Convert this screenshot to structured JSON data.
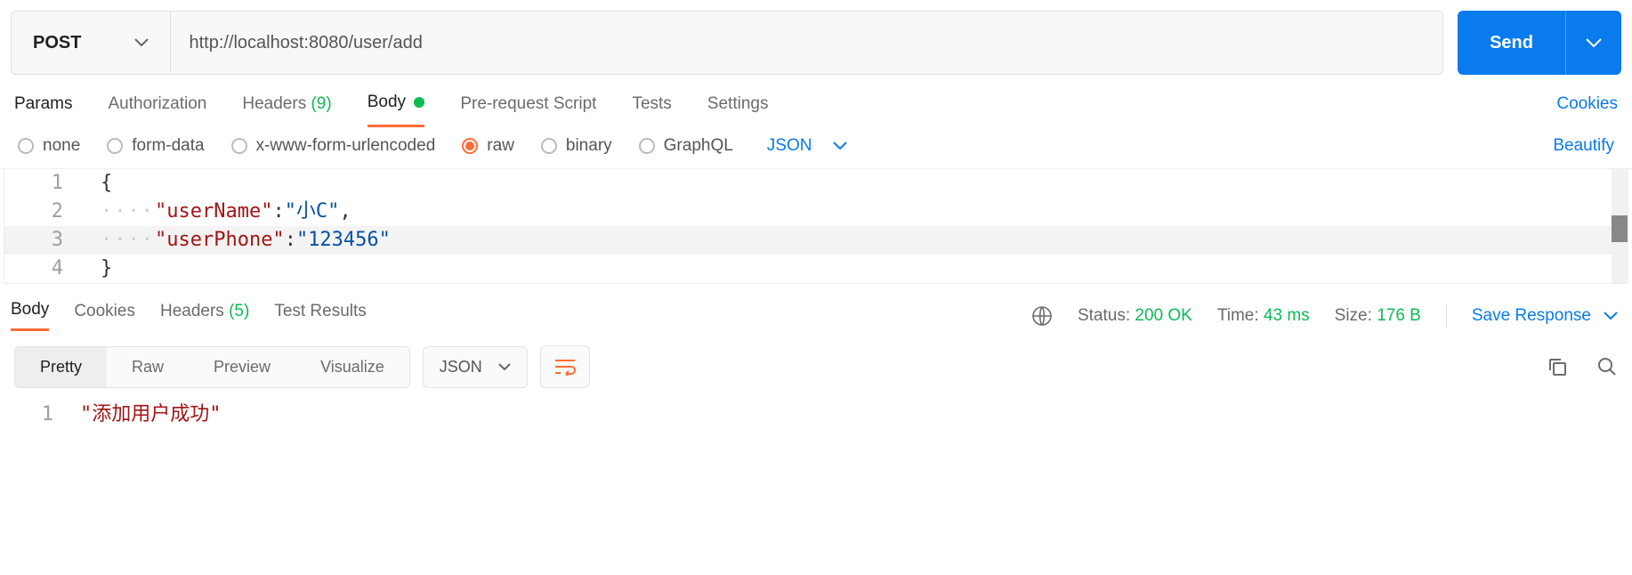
{
  "url_bar": {
    "method": "POST",
    "url": "http://localhost:8080/user/add",
    "send_label": "Send"
  },
  "request_tabs": {
    "params": "Params",
    "authorization": "Authorization",
    "headers": "Headers",
    "headers_count": "(9)",
    "body": "Body",
    "pre_request": "Pre-request Script",
    "tests": "Tests",
    "settings": "Settings",
    "cookies_link": "Cookies"
  },
  "body_types": {
    "none": "none",
    "form_data": "form-data",
    "x_www": "x-www-form-urlencoded",
    "raw": "raw",
    "binary": "binary",
    "graphql": "GraphQL",
    "format_label": "JSON",
    "beautify": "Beautify"
  },
  "editor": {
    "lines": {
      "l1": {
        "num": "1",
        "content": "{"
      },
      "l2": {
        "num": "2",
        "key": "\"userName\"",
        "val": "\"小C\""
      },
      "l3": {
        "num": "3",
        "key": "\"userPhone\"",
        "val": "\"123456\""
      },
      "l4": {
        "num": "4",
        "content": "}"
      }
    }
  },
  "response_header": {
    "body": "Body",
    "cookies": "Cookies",
    "headers": "Headers",
    "headers_count": "(5)",
    "test_results": "Test Results",
    "status_label": "Status:",
    "status_value": "200 OK",
    "time_label": "Time:",
    "time_value": "43 ms",
    "size_label": "Size:",
    "size_value": "176 B",
    "save_response": "Save Response"
  },
  "response_format": {
    "pretty": "Pretty",
    "raw": "Raw",
    "preview": "Preview",
    "visualize": "Visualize",
    "format_label": "JSON"
  },
  "response_body": {
    "line1_num": "1",
    "line1_text": "\"添加用户成功\""
  }
}
